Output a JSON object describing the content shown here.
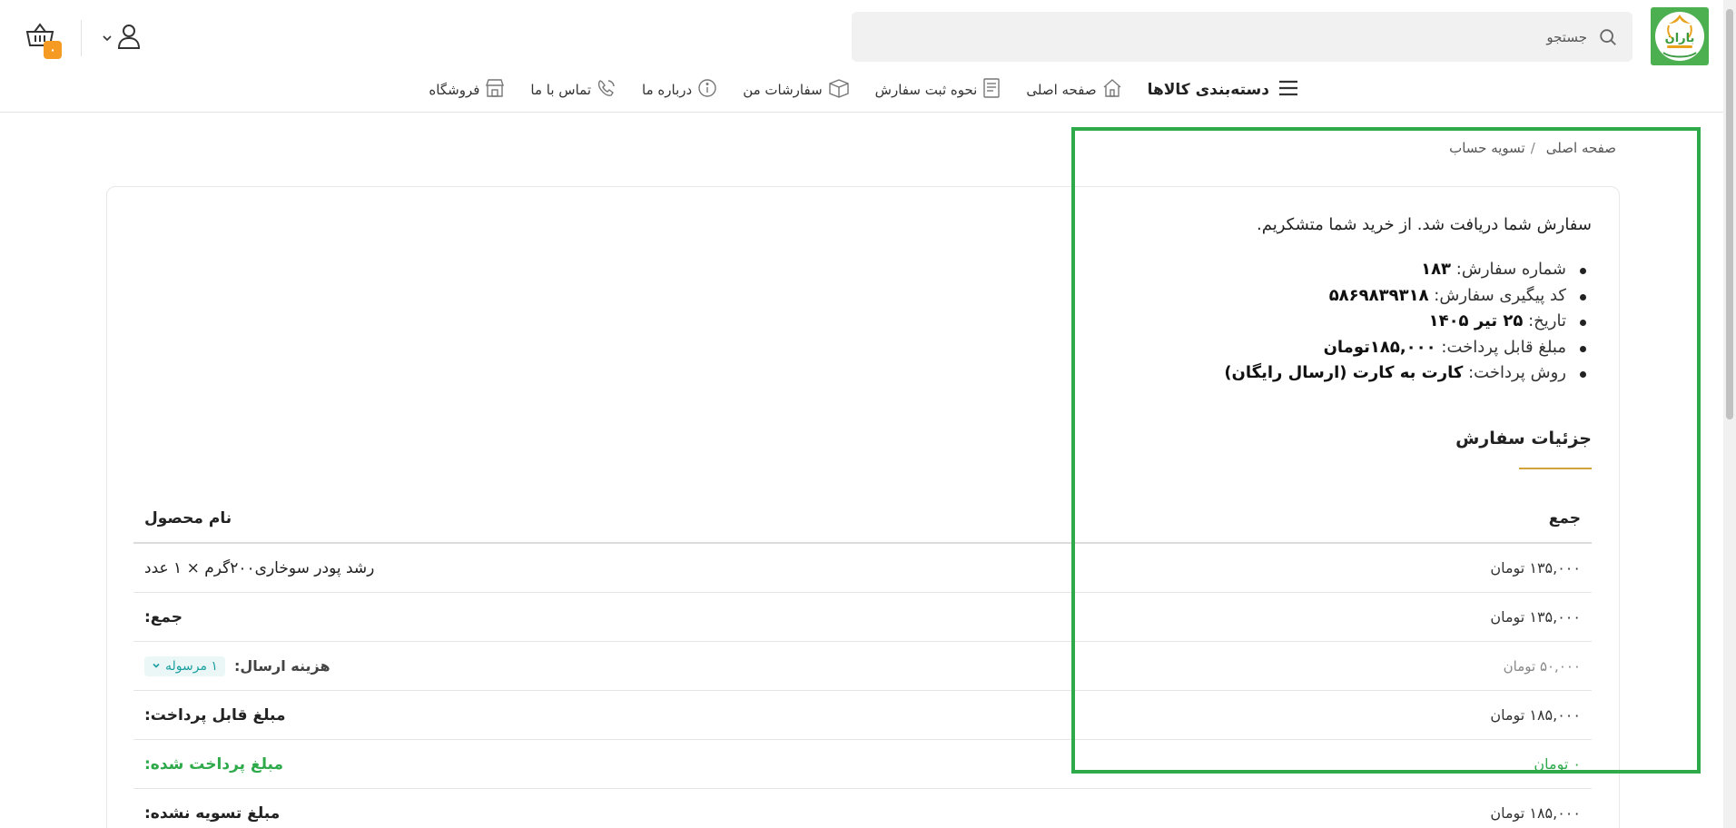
{
  "header": {
    "logo_text": "باران",
    "search": {
      "placeholder": "جستجو",
      "value": ""
    },
    "cart_count": "۰"
  },
  "nav": {
    "items": [
      {
        "label": "دسته‌بندی کالاها",
        "icon": "menu-icon"
      },
      {
        "label": "صفحه اصلی",
        "icon": "home-icon"
      },
      {
        "label": "نحوه ثبت سفارش",
        "icon": "document-icon"
      },
      {
        "label": "سفارشات من",
        "icon": "package-icon"
      },
      {
        "label": "درباره ما",
        "icon": "info-icon"
      },
      {
        "label": "تماس با ما",
        "icon": "contact-icon"
      },
      {
        "label": "فروشگاه",
        "icon": "store-icon"
      }
    ]
  },
  "breadcrumb": {
    "home": "صفحه اصلی",
    "separator": "/",
    "current": "تسویه حساب"
  },
  "order": {
    "thanks": "سفارش شما دریافت شد. از خرید شما متشکریم.",
    "info": [
      {
        "label": "شماره سفارش:",
        "value": "۱۸۳"
      },
      {
        "label": "کد پیگیری سفارش:",
        "value": "۵۸۶۹۸۳۹۳۱۸"
      },
      {
        "label": "تاریخ:",
        "value": "۲۵ تیر ۱۴۰۵"
      },
      {
        "label": "مبلغ قابل پرداخت:",
        "value": "۱۸۵,۰۰۰تومان"
      },
      {
        "label": "روش پرداخت:",
        "value": "کارت به کارت (ارسال رایگان)"
      }
    ],
    "details_title": "جزئیات سفارش",
    "table": {
      "head": {
        "product": "نام محصول",
        "total": "جمع"
      },
      "item": {
        "name": "رشد پودر سوخاری۲۰۰گرم × ۱ عدد",
        "total": "۱۳۵,۰۰۰ تومان"
      },
      "subtotal": {
        "label": "جمع:",
        "value": "۱۳۵,۰۰۰ تومان"
      },
      "shipping": {
        "label": "هزینه ارسال:",
        "pill": "۱ مرسوله",
        "value": "۵۰,۰۰۰ تومان"
      },
      "payable": {
        "label": "مبلغ قابل پرداخت:",
        "value": "۱۸۵,۰۰۰ تومان"
      },
      "paid": {
        "label": "مبلغ پرداخت شده:",
        "value": "۰ تومان"
      },
      "unsettled": {
        "label": "مبلغ تسویه نشده:",
        "value": "۱۸۵,۰۰۰ تومان"
      }
    }
  },
  "colors": {
    "accent_green": "#2eaa4b",
    "badge_orange": "#f59a23",
    "underline_gold": "#d4a23a",
    "pill_teal": "#1a9fa0"
  }
}
